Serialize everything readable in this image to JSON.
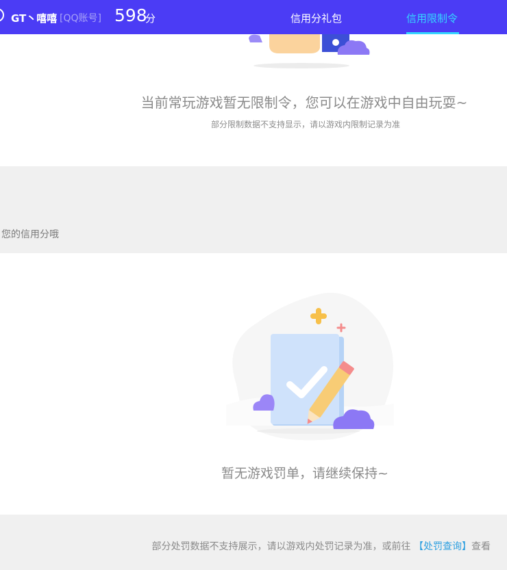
{
  "header": {
    "user_name": "GT丶嘻嘻",
    "account_type": "[QQ账号]",
    "score": "598",
    "score_unit": "分",
    "tabs": [
      {
        "label": "信用分礼包",
        "active": false
      },
      {
        "label": "信用限制令",
        "active": true
      }
    ]
  },
  "limit_section": {
    "title": "当前常玩游戏暂无限制令，您可以在游戏中自由玩耍~",
    "note": "部分限制数据不支持显示，请以游戏内限制记录为准"
  },
  "credit_section": {
    "label": "您的信用分哦"
  },
  "penalty_section": {
    "title": "暂无游戏罚单，请继续保持~"
  },
  "footer": {
    "text_before": "部分处罚数据不支持展示，请以游戏内处罚记录为准，或前往 ",
    "link_label": "【处罚查询】",
    "text_after": "查看"
  },
  "colors": {
    "header_bg": "#4b3cf5",
    "active_tab": "#35d6ff",
    "link": "#2c9fe0",
    "page_bg": "#f0f0f0"
  }
}
